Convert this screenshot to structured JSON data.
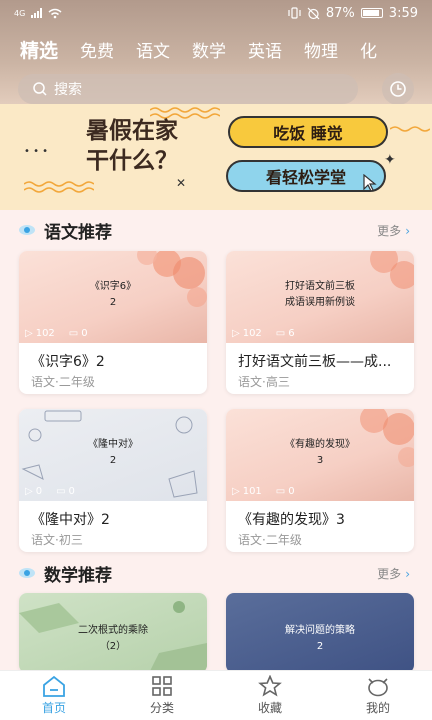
{
  "status_bar": {
    "network": "4G",
    "battery": "87%",
    "time": "3:59"
  },
  "nav_tabs": [
    "精选",
    "免费",
    "语文",
    "数学",
    "英语",
    "物理",
    "化"
  ],
  "search": {
    "placeholder": "搜索"
  },
  "banner": {
    "title_line1": "暑假在家",
    "title_line2": "干什么？",
    "pill1": "吃饭 睡觉",
    "pill2": "看轻松学堂"
  },
  "sections": [
    {
      "title": "语文推荐",
      "more": "更多",
      "cards": [
        {
          "thumb_text": [
            "《识字6》",
            "2"
          ],
          "plays": "102",
          "comments": "0",
          "title": "《识字6》2",
          "sub": "语文·二年级"
        },
        {
          "thumb_text": [
            "打好语文前三板",
            "成语误用新例谈"
          ],
          "plays": "102",
          "comments": "6",
          "title": "打好语文前三板——成...",
          "sub": "语文·高三"
        },
        {
          "thumb_text": [
            "《隆中对》",
            "2"
          ],
          "plays": "0",
          "comments": "0",
          "title": "《隆中对》2",
          "sub": "语文·初三"
        },
        {
          "thumb_text": [
            "《有趣的发现》",
            "3"
          ],
          "plays": "101",
          "comments": "0",
          "title": "《有趣的发现》3",
          "sub": "语文·二年级"
        }
      ]
    },
    {
      "title": "数学推荐",
      "more": "更多",
      "cards": [
        {
          "thumb_text": [
            "二次根式的乘除",
            "（2）"
          ]
        },
        {
          "thumb_text": [
            "解决问题的策略",
            "2"
          ]
        }
      ]
    }
  ],
  "bottom_nav": [
    "首页",
    "分类",
    "收藏",
    "我的"
  ],
  "colors": {
    "accent": "#3aa3e3",
    "banner_yellow": "#f8c93d",
    "banner_blue": "#8fd4ec"
  }
}
